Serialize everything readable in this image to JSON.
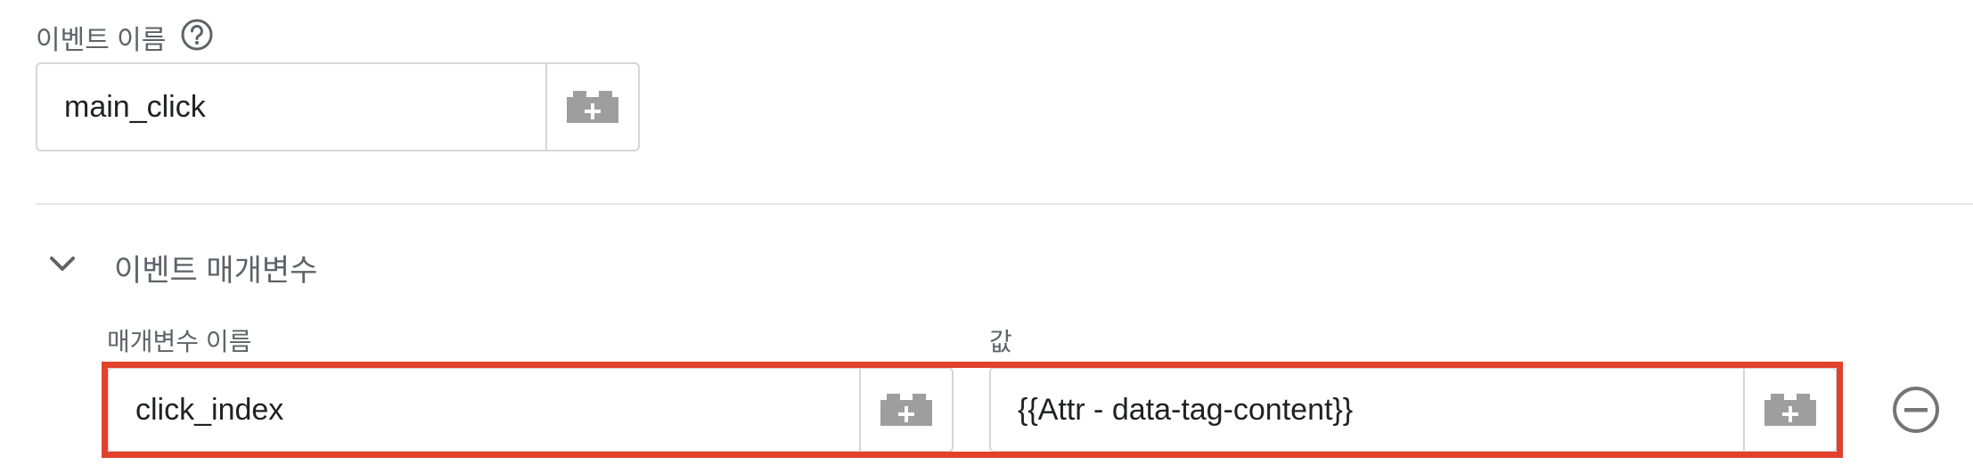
{
  "event_name": {
    "label": "이벤트 이름",
    "help_icon": "help-circle-icon",
    "value": "main_click",
    "variable_icon": "add-variable-brick-icon"
  },
  "event_params_section": {
    "title": "이벤트 매개변수",
    "toggle_icon": "chevron-down-icon",
    "column_name_label": "매개변수 이름",
    "column_value_label": "값",
    "rows": [
      {
        "name": "click_index",
        "value": "{{Attr - data-tag-content}}",
        "remove_icon": "minus-circle-icon"
      }
    ]
  },
  "colors": {
    "highlight": "#e2412b",
    "icon_gray": "#9e9e9e",
    "label_gray": "#5f6368"
  }
}
